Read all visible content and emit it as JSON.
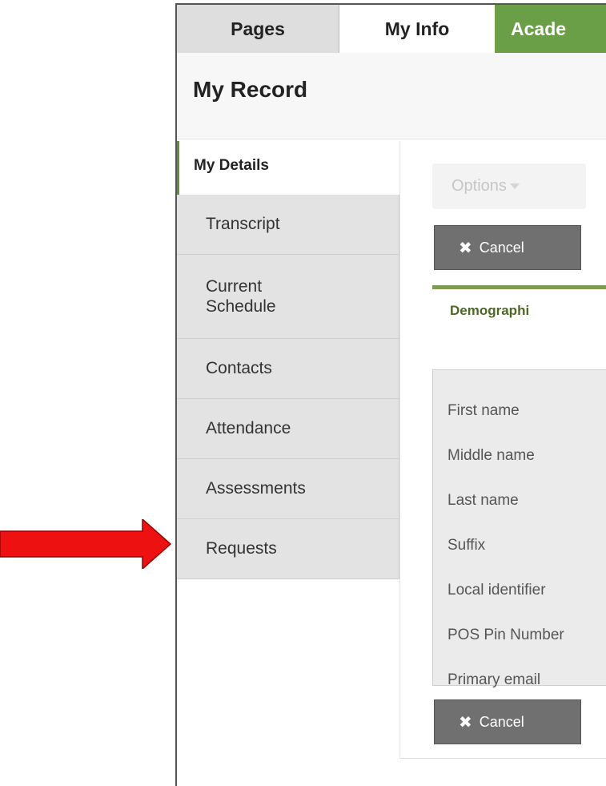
{
  "tabs": {
    "pages": "Pages",
    "my_info": "My Info",
    "academics": "Acade"
  },
  "header": {
    "title": "My Record"
  },
  "sidebar": {
    "active": "My Details",
    "items": [
      {
        "label": "Transcript"
      },
      {
        "label": "Current\nSchedule"
      },
      {
        "label": "Contacts"
      },
      {
        "label": "Attendance"
      },
      {
        "label": "Assessments"
      },
      {
        "label": "Requests"
      }
    ]
  },
  "toolbar": {
    "options_label": "Options",
    "cancel_label": "Cancel"
  },
  "subtab": {
    "label": "Demographi"
  },
  "fields": {
    "labels": [
      "First name",
      "Middle name",
      "Last name",
      "Suffix",
      "Local identifier",
      "POS Pin Number",
      "Primary email"
    ]
  },
  "colors": {
    "accent_green": "#6a9f48",
    "arrow_red": "#ee1111"
  },
  "icons": {
    "arrow": "right-arrow-icon",
    "cancel": "x-icon",
    "caret": "caret-down-icon"
  }
}
